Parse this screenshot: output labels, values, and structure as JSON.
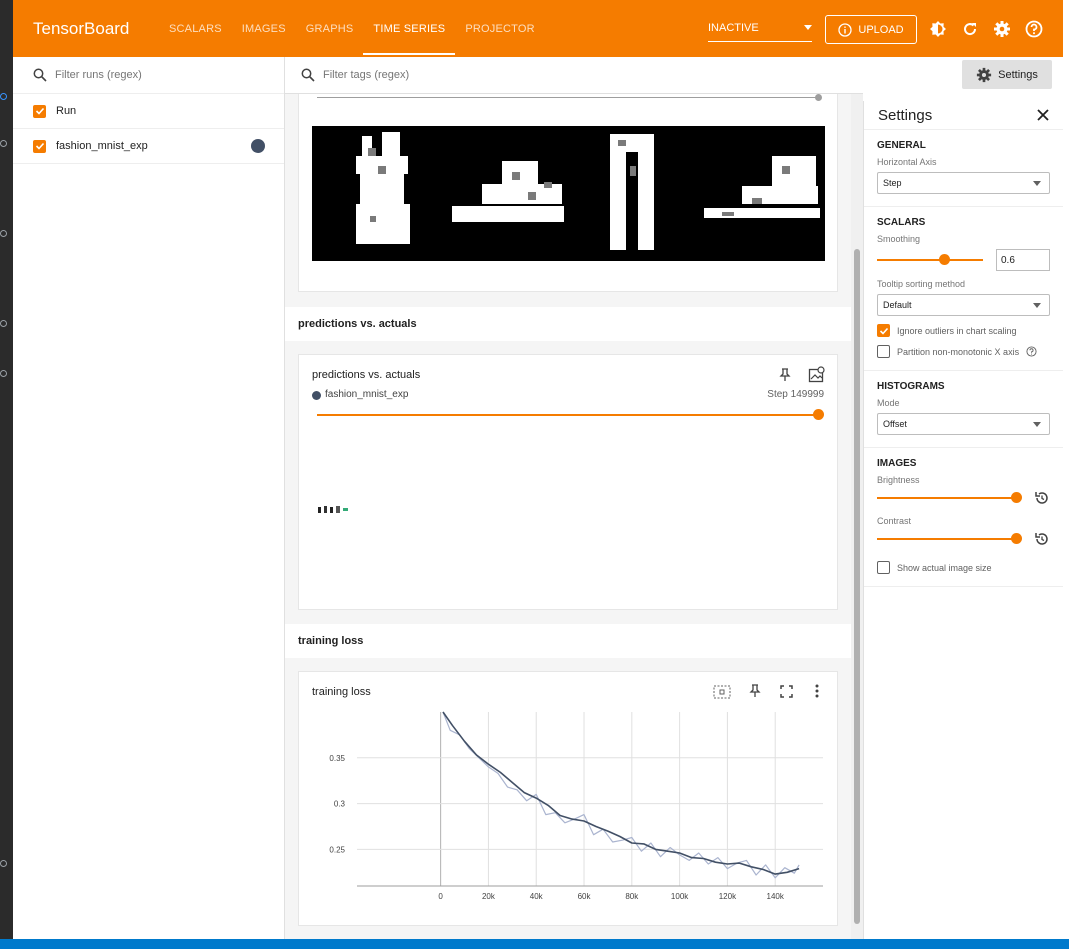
{
  "app": {
    "brand": "TensorBoard"
  },
  "nav": {
    "tabs": [
      "SCALARS",
      "IMAGES",
      "GRAPHS",
      "TIME SERIES",
      "PROJECTOR"
    ],
    "active": "TIME SERIES"
  },
  "header": {
    "reload_status": "INACTIVE",
    "upload_label": "UPLOAD"
  },
  "runs": {
    "filter_placeholder": "Filter runs (regex)",
    "header_label": "Run",
    "items": [
      {
        "name": "fashion_mnist_exp",
        "checked": true,
        "color": "#425066"
      }
    ]
  },
  "main": {
    "tag_filter_placeholder": "Filter tags (regex)",
    "settings_button": "Settings",
    "groups": [
      {
        "title": "predictions vs. actuals",
        "card": {
          "title": "predictions vs. actuals",
          "run": "fashion_mnist_exp",
          "step": "Step 149999"
        }
      },
      {
        "title": "training loss",
        "card": {
          "title": "training loss"
        }
      }
    ]
  },
  "settings": {
    "title": "Settings",
    "general": {
      "title": "GENERAL",
      "horizontal_axis_label": "Horizontal Axis",
      "horizontal_axis_value": "Step"
    },
    "scalars": {
      "title": "SCALARS",
      "smoothing_label": "Smoothing",
      "smoothing_value": "0.6",
      "tooltip_label": "Tooltip sorting method",
      "tooltip_value": "Default",
      "ignore_outliers": "Ignore outliers in chart scaling",
      "partition": "Partition non-monotonic X axis"
    },
    "histograms": {
      "title": "HISTOGRAMS",
      "mode_label": "Mode",
      "mode_value": "Offset"
    },
    "images": {
      "title": "IMAGES",
      "brightness_label": "Brightness",
      "contrast_label": "Contrast",
      "actual_size": "Show actual image size"
    }
  },
  "chart_data": {
    "type": "line",
    "title": "training loss",
    "x_ticks": [
      "0",
      "20k",
      "40k",
      "60k",
      "80k",
      "100k",
      "120k",
      "140k"
    ],
    "y_ticks": [
      "0.25",
      "0.3",
      "0.35"
    ],
    "xlim": [
      -35000,
      160000
    ],
    "ylim": [
      0.21,
      0.4
    ],
    "grid": true,
    "series": [
      {
        "color": "#425066",
        "x": [
          1000,
          5000,
          10000,
          15000,
          20000,
          25000,
          30000,
          35000,
          40000,
          45000,
          50000,
          55000,
          60000,
          65000,
          70000,
          75000,
          80000,
          85000,
          90000,
          95000,
          100000,
          105000,
          110000,
          115000,
          120000,
          125000,
          130000,
          135000,
          140000,
          145000,
          150000
        ],
        "y": [
          0.4,
          0.385,
          0.368,
          0.353,
          0.343,
          0.334,
          0.323,
          0.312,
          0.306,
          0.298,
          0.287,
          0.283,
          0.281,
          0.275,
          0.27,
          0.264,
          0.257,
          0.256,
          0.25,
          0.248,
          0.246,
          0.241,
          0.24,
          0.236,
          0.234,
          0.235,
          0.231,
          0.228,
          0.223,
          0.225,
          0.229
        ]
      },
      {
        "color": "#aab4cf",
        "x": [
          1000,
          4000,
          8000,
          12000,
          16000,
          20000,
          24000,
          28000,
          32000,
          36000,
          40000,
          44000,
          48000,
          52000,
          56000,
          60000,
          64000,
          68000,
          72000,
          76000,
          80000,
          84000,
          88000,
          92000,
          96000,
          100000,
          104000,
          108000,
          112000,
          116000,
          120000,
          124000,
          128000,
          132000,
          136000,
          140000,
          144000,
          148000,
          150000
        ],
        "y": [
          0.4,
          0.38,
          0.375,
          0.36,
          0.35,
          0.34,
          0.333,
          0.318,
          0.315,
          0.303,
          0.31,
          0.288,
          0.29,
          0.279,
          0.283,
          0.288,
          0.266,
          0.272,
          0.258,
          0.26,
          0.263,
          0.248,
          0.257,
          0.242,
          0.252,
          0.244,
          0.238,
          0.246,
          0.234,
          0.241,
          0.229,
          0.235,
          0.238,
          0.222,
          0.233,
          0.219,
          0.23,
          0.224,
          0.233
        ]
      }
    ]
  }
}
